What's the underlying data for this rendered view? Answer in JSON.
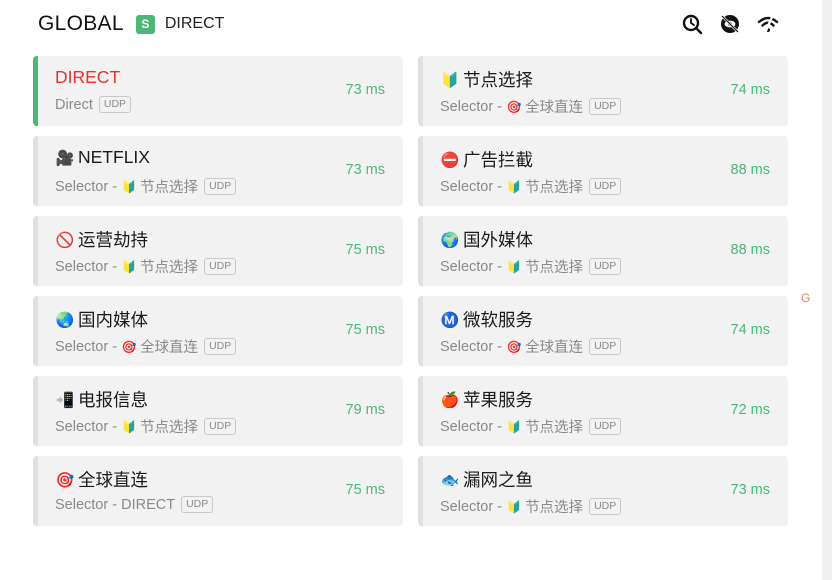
{
  "header": {
    "group_name": "GLOBAL",
    "mode_badge": "S",
    "current_node": "DIRECT",
    "icons": [
      "search-delay-icon",
      "hide-unavailable-icon",
      "wifi-icon"
    ]
  },
  "proxies": [
    {
      "emoji": "",
      "name": "DIRECT",
      "type": "Direct",
      "via_emoji": "",
      "via": "",
      "udp": "UDP",
      "latency": "73 ms",
      "selected": true
    },
    {
      "emoji": "🔰",
      "name": "节点选择",
      "type": "Selector",
      "via_emoji": "🎯",
      "via": "全球直连",
      "udp": "UDP",
      "latency": "74 ms"
    },
    {
      "emoji": "🎥",
      "name": "NETFLIX",
      "type": "Selector",
      "via_emoji": "🔰",
      "via": "节点选择",
      "udp": "UDP",
      "latency": "73 ms"
    },
    {
      "emoji": "⛔",
      "name": "广告拦截",
      "type": "Selector",
      "via_emoji": "🔰",
      "via": "节点选择",
      "udp": "UDP",
      "latency": "88 ms"
    },
    {
      "emoji": "🚫",
      "name": "运营劫持",
      "type": "Selector",
      "via_emoji": "🔰",
      "via": "节点选择",
      "udp": "UDP",
      "latency": "75 ms"
    },
    {
      "emoji": "🌍",
      "name": "国外媒体",
      "type": "Selector",
      "via_emoji": "🔰",
      "via": "节点选择",
      "udp": "UDP",
      "latency": "88 ms"
    },
    {
      "emoji": "🌏",
      "name": "国内媒体",
      "type": "Selector",
      "via_emoji": "🎯",
      "via": "全球直连",
      "udp": "UDP",
      "latency": "75 ms"
    },
    {
      "emoji": "Ⓜ️",
      "name": "微软服务",
      "type": "Selector",
      "via_emoji": "🎯",
      "via": "全球直连",
      "udp": "UDP",
      "latency": "74 ms"
    },
    {
      "emoji": "📲",
      "name": "电报信息",
      "type": "Selector",
      "via_emoji": "🔰",
      "via": "节点选择",
      "udp": "UDP",
      "latency": "79 ms"
    },
    {
      "emoji": "🍎",
      "name": "苹果服务",
      "type": "Selector",
      "via_emoji": "🔰",
      "via": "节点选择",
      "udp": "UDP",
      "latency": "72 ms"
    },
    {
      "emoji": "🎯",
      "name": "全球直连",
      "type": "Selector",
      "via_emoji": "",
      "via": "DIRECT",
      "udp": "UDP",
      "latency": "75 ms"
    },
    {
      "emoji": "🐟",
      "name": "漏网之鱼",
      "type": "Selector",
      "via_emoji": "🔰",
      "via": "节点选择",
      "udp": "UDP",
      "latency": "73 ms"
    }
  ],
  "side_letter": "G",
  "colors": {
    "accent": "#4bb878",
    "selected_name": "#e8332d",
    "card_bg": "#f2f2f2"
  }
}
